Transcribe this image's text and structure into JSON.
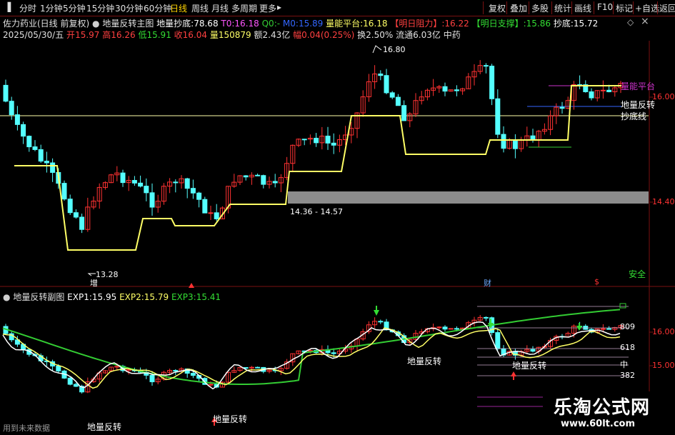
{
  "toolbar": {
    "periods": [
      "分时",
      "1分钟",
      "5分钟",
      "15分钟",
      "30分钟",
      "60分钟",
      "日线",
      "周线",
      "月线",
      "多周期",
      "更多"
    ],
    "active": "日线",
    "more_arrow": "▸",
    "right_buttons": [
      "复权",
      "叠加",
      "多股",
      "统计",
      "画线",
      "F10",
      "标记",
      "+自选",
      "返回"
    ]
  },
  "main": {
    "stock_name": "佐力药业(日线 前复权)",
    "indicator_name": "地量反转主图",
    "dilang_label": "地量抄底:",
    "dilang_value": "78.68",
    "t0_label": "T0:",
    "t0_value": "16.18",
    "q0_label": "Q0:",
    "q0_value": "-",
    "m0_label": "M0:",
    "m0_value": "15.89",
    "platform_label": "量能平台:",
    "platform_value": "16.18",
    "resistance_label": "【明日阻力】:",
    "resistance_value": "16.22",
    "support_label": "【明日支撑】:",
    "support_value": "15.86",
    "bottom_label": "抄底:",
    "bottom_value": "15.72",
    "date": "2025/05/30/五",
    "open_label": "开",
    "open": "15.97",
    "high_label": "高",
    "high": "16.26",
    "low_label": "低",
    "low": "15.91",
    "close_label": "收",
    "close": "16.04",
    "volume_label": "量",
    "volume": "150879",
    "amount_label": "额",
    "amount": "2.43亿",
    "change_label": "幅",
    "change": "0.04(0.25%)",
    "turnover_label": "换",
    "turnover": "2.50%",
    "float_label": "流通",
    "float_cap": "6.03亿",
    "sector": "中药",
    "price_axis": [
      "16.00",
      "14.40"
    ],
    "annot_high": "16.80",
    "annot_low": "13.28",
    "annot_range": "14.36 - 14.57",
    "label_platform": "量能平台",
    "label_reversal": "地量反转",
    "label_bottom_line": "抄底线",
    "marker_zeng": "增",
    "marker_cai": "财",
    "marker_dollar": "$",
    "safe_label": "安全"
  },
  "sub": {
    "indicator_name": "地量反转副图",
    "exp1_label": "EXP1:",
    "exp1": "15.95",
    "exp2_label": "EXP2:",
    "exp2": "15.79",
    "exp3_label": "EXP3:",
    "exp3": "15.41",
    "price_axis": [
      "16.00",
      "15.00"
    ],
    "levels": [
      "809",
      "618",
      "中",
      "382"
    ],
    "signal_label": "地量反转"
  },
  "footer": {
    "future_data": "用到未来数据"
  },
  "watermark": {
    "title": "乐淘公式网",
    "url": "www.60lt.com"
  },
  "colors": {
    "up": "#ff3232",
    "down": "#54ffff",
    "platform": "#ffff66",
    "exp1": "#ffffff",
    "exp2": "#ffff66",
    "exp3": "#33cc33",
    "resistance": "#cc33cc",
    "support": "#3399ff"
  },
  "icons": [
    "settings-dot-icon",
    "diamond-icon",
    "close-icon",
    "up-arrow-icon",
    "down-arrow-icon"
  ]
}
